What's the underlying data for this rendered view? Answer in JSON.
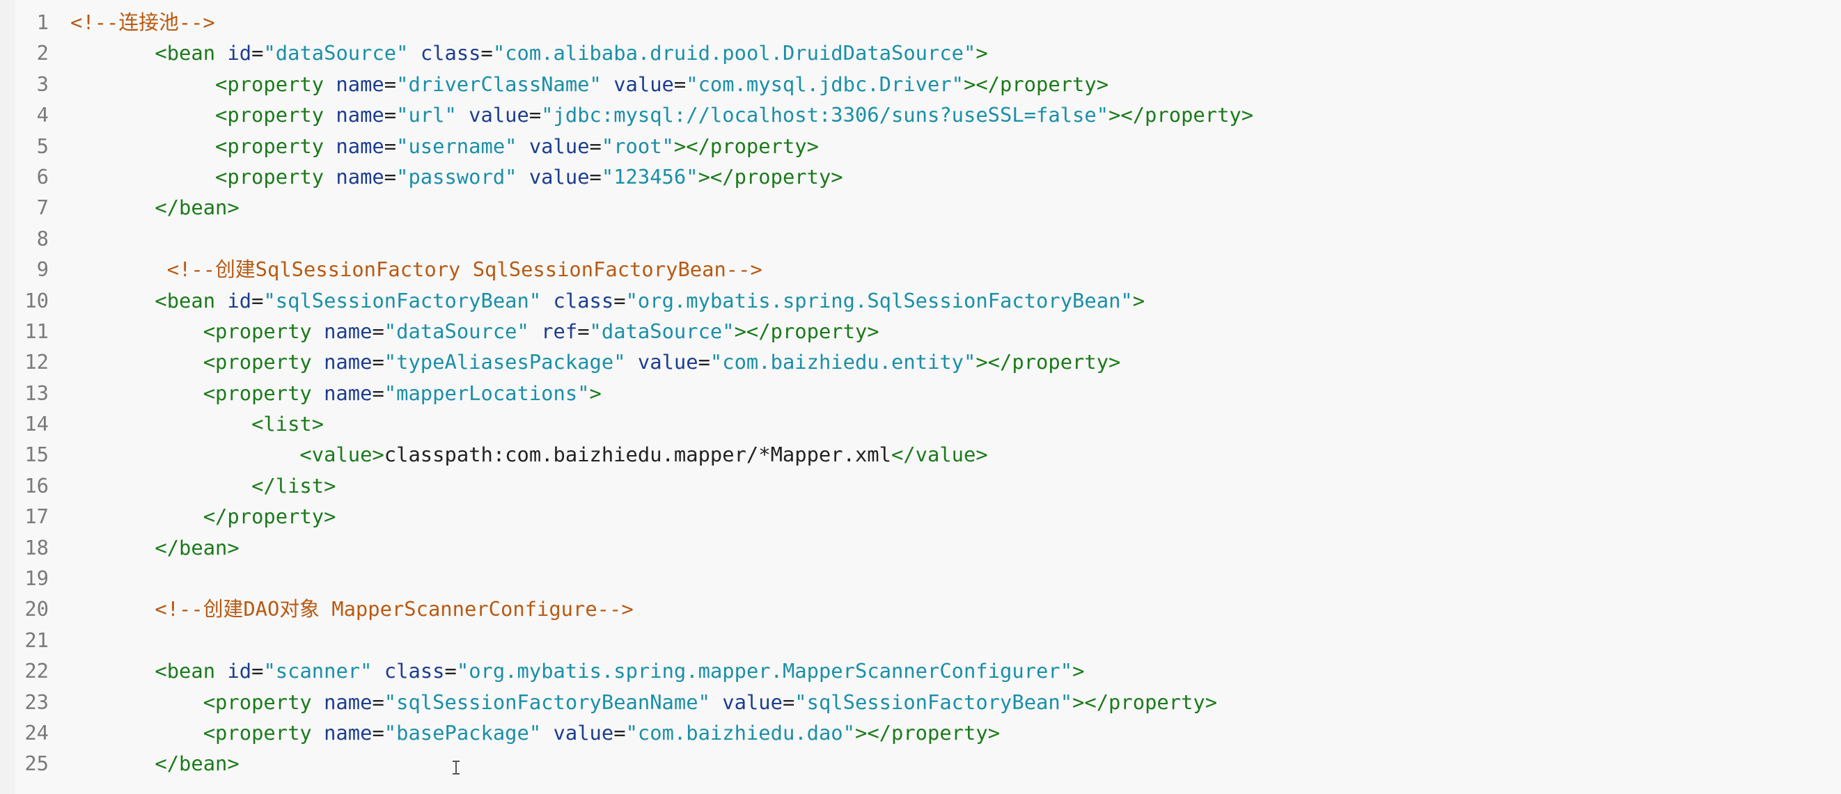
{
  "editor": {
    "lines": [
      {
        "num": "1",
        "indent": "",
        "tokens": [
          [
            "cmt",
            "<!--连接池-->"
          ]
        ]
      },
      {
        "num": "2",
        "indent": "       ",
        "tokens": [
          [
            "tag",
            "<bean "
          ],
          [
            "attr",
            "id"
          ],
          [
            "plain",
            "="
          ],
          [
            "str",
            "\"dataSource\""
          ],
          [
            "plain",
            " "
          ],
          [
            "attr",
            "class"
          ],
          [
            "plain",
            "="
          ],
          [
            "str",
            "\"com.alibaba.druid.pool.DruidDataSource\""
          ],
          [
            "tag",
            ">"
          ]
        ]
      },
      {
        "num": "3",
        "indent": "            ",
        "tokens": [
          [
            "tag",
            "<property "
          ],
          [
            "attr",
            "name"
          ],
          [
            "plain",
            "="
          ],
          [
            "str",
            "\"driverClassName\""
          ],
          [
            "plain",
            " "
          ],
          [
            "attr",
            "value"
          ],
          [
            "plain",
            "="
          ],
          [
            "str",
            "\"com.mysql.jdbc.Driver\""
          ],
          [
            "tag",
            "></property>"
          ]
        ]
      },
      {
        "num": "4",
        "indent": "            ",
        "tokens": [
          [
            "tag",
            "<property "
          ],
          [
            "attr",
            "name"
          ],
          [
            "plain",
            "="
          ],
          [
            "str",
            "\"url\""
          ],
          [
            "plain",
            " "
          ],
          [
            "attr",
            "value"
          ],
          [
            "plain",
            "="
          ],
          [
            "str",
            "\"jdbc:mysql://localhost:3306/suns?useSSL=false\""
          ],
          [
            "tag",
            "></property>"
          ]
        ]
      },
      {
        "num": "5",
        "indent": "            ",
        "tokens": [
          [
            "tag",
            "<property "
          ],
          [
            "attr",
            "name"
          ],
          [
            "plain",
            "="
          ],
          [
            "str",
            "\"username\""
          ],
          [
            "plain",
            " "
          ],
          [
            "attr",
            "value"
          ],
          [
            "plain",
            "="
          ],
          [
            "str",
            "\"root\""
          ],
          [
            "tag",
            "></property>"
          ]
        ]
      },
      {
        "num": "6",
        "indent": "            ",
        "tokens": [
          [
            "tag",
            "<property "
          ],
          [
            "attr",
            "name"
          ],
          [
            "plain",
            "="
          ],
          [
            "str",
            "\"password\""
          ],
          [
            "plain",
            " "
          ],
          [
            "attr",
            "value"
          ],
          [
            "plain",
            "="
          ],
          [
            "str",
            "\"123456\""
          ],
          [
            "tag",
            "></property>"
          ]
        ]
      },
      {
        "num": "7",
        "indent": "       ",
        "tokens": [
          [
            "tag",
            "</bean>"
          ]
        ]
      },
      {
        "num": "8",
        "indent": "",
        "tokens": []
      },
      {
        "num": "9",
        "indent": "        ",
        "tokens": [
          [
            "cmt",
            "<!--创建SqlSessionFactory SqlSessionFactoryBean-->"
          ]
        ]
      },
      {
        "num": "10",
        "indent": "       ",
        "tokens": [
          [
            "tag",
            "<bean "
          ],
          [
            "attr",
            "id"
          ],
          [
            "plain",
            "="
          ],
          [
            "str",
            "\"sqlSessionFactoryBean\""
          ],
          [
            "plain",
            " "
          ],
          [
            "attr",
            "class"
          ],
          [
            "plain",
            "="
          ],
          [
            "str",
            "\"org.mybatis.spring.SqlSessionFactoryBean\""
          ],
          [
            "tag",
            ">"
          ]
        ]
      },
      {
        "num": "11",
        "indent": "           ",
        "tokens": [
          [
            "tag",
            "<property "
          ],
          [
            "attr",
            "name"
          ],
          [
            "plain",
            "="
          ],
          [
            "str",
            "\"dataSource\""
          ],
          [
            "plain",
            " "
          ],
          [
            "attr",
            "ref"
          ],
          [
            "plain",
            "="
          ],
          [
            "str",
            "\"dataSource\""
          ],
          [
            "tag",
            "></property>"
          ]
        ]
      },
      {
        "num": "12",
        "indent": "           ",
        "tokens": [
          [
            "tag",
            "<property "
          ],
          [
            "attr",
            "name"
          ],
          [
            "plain",
            "="
          ],
          [
            "str",
            "\"typeAliasesPackage\""
          ],
          [
            "plain",
            " "
          ],
          [
            "attr",
            "value"
          ],
          [
            "plain",
            "="
          ],
          [
            "str",
            "\"com.baizhiedu.entity\""
          ],
          [
            "tag",
            "></property>"
          ]
        ]
      },
      {
        "num": "13",
        "indent": "           ",
        "tokens": [
          [
            "tag",
            "<property "
          ],
          [
            "attr",
            "name"
          ],
          [
            "plain",
            "="
          ],
          [
            "str",
            "\"mapperLocations\""
          ],
          [
            "tag",
            ">"
          ]
        ]
      },
      {
        "num": "14",
        "indent": "               ",
        "tokens": [
          [
            "tag",
            "<list>"
          ]
        ]
      },
      {
        "num": "15",
        "indent": "                   ",
        "tokens": [
          [
            "tag",
            "<value>"
          ],
          [
            "plain",
            "classpath:com.baizhiedu.mapper/*Mapper.xml"
          ],
          [
            "tag",
            "</value>"
          ]
        ]
      },
      {
        "num": "16",
        "indent": "               ",
        "tokens": [
          [
            "tag",
            "</list>"
          ]
        ]
      },
      {
        "num": "17",
        "indent": "           ",
        "tokens": [
          [
            "tag",
            "</property>"
          ]
        ]
      },
      {
        "num": "18",
        "indent": "       ",
        "tokens": [
          [
            "tag",
            "</bean>"
          ]
        ]
      },
      {
        "num": "19",
        "indent": "",
        "tokens": []
      },
      {
        "num": "20",
        "indent": "       ",
        "tokens": [
          [
            "cmt",
            "<!--创建DAO对象 MapperScannerConfigure-->"
          ]
        ]
      },
      {
        "num": "21",
        "indent": "",
        "tokens": []
      },
      {
        "num": "22",
        "indent": "       ",
        "tokens": [
          [
            "tag",
            "<bean "
          ],
          [
            "attr",
            "id"
          ],
          [
            "plain",
            "="
          ],
          [
            "str",
            "\"scanner\""
          ],
          [
            "plain",
            " "
          ],
          [
            "attr",
            "class"
          ],
          [
            "plain",
            "="
          ],
          [
            "str",
            "\"org.mybatis.spring.mapper.MapperScannerConfigurer\""
          ],
          [
            "tag",
            ">"
          ]
        ]
      },
      {
        "num": "23",
        "indent": "           ",
        "tokens": [
          [
            "tag",
            "<property "
          ],
          [
            "attr",
            "name"
          ],
          [
            "plain",
            "="
          ],
          [
            "str",
            "\"sqlSessionFactoryBeanName\""
          ],
          [
            "plain",
            " "
          ],
          [
            "attr",
            "value"
          ],
          [
            "plain",
            "="
          ],
          [
            "str",
            "\"sqlSessionFactoryBean\""
          ],
          [
            "tag",
            "></property>"
          ]
        ]
      },
      {
        "num": "24",
        "indent": "           ",
        "tokens": [
          [
            "tag",
            "<property "
          ],
          [
            "attr",
            "name"
          ],
          [
            "plain",
            "="
          ],
          [
            "str",
            "\"basePackage\""
          ],
          [
            "plain",
            " "
          ],
          [
            "attr",
            "value"
          ],
          [
            "plain",
            "="
          ],
          [
            "str",
            "\"com.baizhiedu.dao\""
          ],
          [
            "tag",
            "></property>"
          ]
        ]
      },
      {
        "num": "25",
        "indent": "       ",
        "tokens": [
          [
            "tag",
            "</bean>"
          ]
        ]
      }
    ]
  },
  "colors": {
    "tag": "#1a7a1a",
    "attribute": "#1c3d8f",
    "string": "#1a8fa8",
    "comment": "#b85a12",
    "line_number": "#7a7a7a",
    "background": "#f8f8f8"
  },
  "cursor": {
    "icon": "text-cursor-icon"
  }
}
